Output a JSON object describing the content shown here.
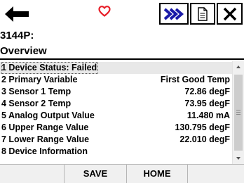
{
  "toolbar": {
    "icons": [
      "back-arrow-icon",
      "favorite-heart-icon",
      "fast-forward-icon",
      "document-icon",
      "close-icon"
    ],
    "heart_color": "#e8202a",
    "accent_color": "#1a1aa8"
  },
  "header": {
    "device": "3144P:",
    "menu": "Overview"
  },
  "rows": [
    {
      "label": "1 Device Status: Failed",
      "value": ""
    },
    {
      "label": "2 Primary Variable",
      "value": "First Good Temp"
    },
    {
      "label": "3 Sensor 1 Temp",
      "value": "72.86 degF"
    },
    {
      "label": "4 Sensor 2 Temp",
      "value": "73.95 degF"
    },
    {
      "label": "5 Analog Output Value",
      "value": "11.480 mA"
    },
    {
      "label": "6 Upper Range Value",
      "value": "130.795 degF"
    },
    {
      "label": "7 Lower Range Value",
      "value": "22.010 degF"
    },
    {
      "label": "8 Device Information",
      "value": ""
    }
  ],
  "footer": {
    "save_label": "SAVE",
    "home_label": "HOME"
  }
}
